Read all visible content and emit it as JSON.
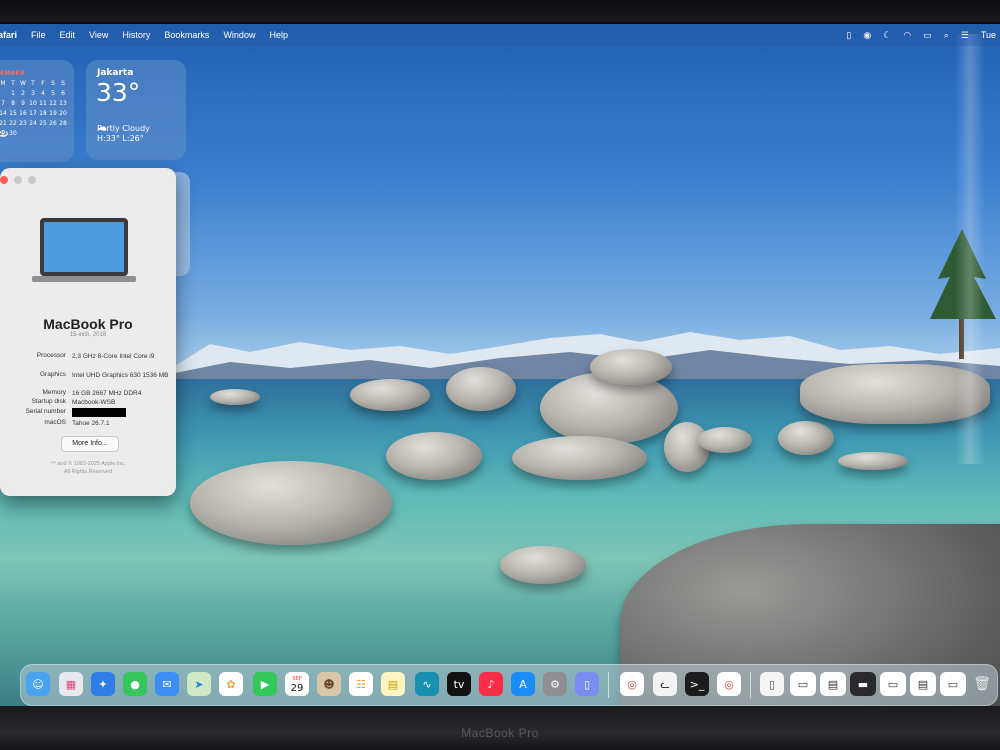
{
  "menubar": {
    "app": "afari",
    "items": [
      "File",
      "Edit",
      "View",
      "History",
      "Bookmarks",
      "Window",
      "Help"
    ],
    "clock": "Tue"
  },
  "calendar_widget": {
    "month": "EMBER",
    "weekdays": [
      "M",
      "T",
      "W",
      "T",
      "F",
      "S",
      "S"
    ],
    "days": [
      "",
      "1",
      "2",
      "3",
      "4",
      "5",
      "6",
      "7",
      "8",
      "9",
      "10",
      "11",
      "12",
      "13",
      "14",
      "15",
      "16",
      "17",
      "18",
      "19",
      "20",
      "21",
      "22",
      "23",
      "24",
      "25",
      "26",
      "28",
      "29",
      "30"
    ],
    "today": "29"
  },
  "weather_widget": {
    "city": "Jakarta",
    "temperature": "33°",
    "condition": "Partly Cloudy",
    "high_low": "H:33° L:26°"
  },
  "about_window": {
    "model": "MacBook Pro",
    "year": "15-inch, 2018",
    "specs": [
      {
        "key": "Processor",
        "value": "2,3 GHz 8-Core Intel Core i9"
      },
      {
        "key": "Graphics",
        "value": "Intel UHD Graphics 630 1536 MB"
      },
      {
        "key": "Memory",
        "value": "16 GB 2667 MHz DDR4"
      },
      {
        "key": "Startup disk",
        "value": "Macbook-WSB"
      },
      {
        "key": "Serial number",
        "value": ""
      },
      {
        "key": "macOS",
        "value": "Tahoe 26.7.1"
      }
    ],
    "more_info_label": "More Info...",
    "copyright": "™ and © 1983-2025 Apple Inc.",
    "rights": "All Rights Reserved"
  },
  "dock": {
    "calendar_day": "29",
    "calendar_month": "SEP"
  },
  "bezel_label": "MacBook Pro",
  "colors": {
    "traffic_close": "#ff5f57",
    "traffic_min": "#c8c8c8",
    "traffic_zoom": "#c8c8c8"
  }
}
